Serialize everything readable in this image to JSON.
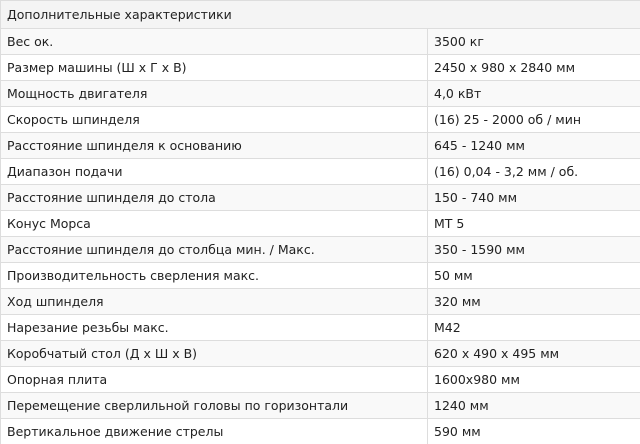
{
  "header": {
    "title": "Дополнительные характеристики"
  },
  "rows": [
    {
      "name": "Вес ок.",
      "value": "3500 кг"
    },
    {
      "name": "Размер машины (Ш х Г х В)",
      "value": "2450 x 980 x 2840 мм"
    },
    {
      "name": "Мощность двигателя",
      "value": "4,0 кВт"
    },
    {
      "name": "Скорость шпинделя",
      "value": "(16) 25 - 2000 об / мин"
    },
    {
      "name": "Расстояние шпинделя к основанию",
      "value": "645 - 1240 мм"
    },
    {
      "name": "Диапазон подачи",
      "value": "(16) 0,04 - 3,2 мм / об."
    },
    {
      "name": "Расстояние шпинделя до стола",
      "value": "150 - 740 мм"
    },
    {
      "name": "Конус Морса",
      "value": "MT 5"
    },
    {
      "name": "Расстояние шпинделя до столбца мин. / Макс.",
      "value": "350 - 1590 мм"
    },
    {
      "name": "Производительность сверления макс.",
      "value": "50 мм"
    },
    {
      "name": "Ход шпинделя",
      "value": "320 мм"
    },
    {
      "name": "Нарезание резьбы макс.",
      "value": "M42"
    },
    {
      "name": "Коробчатый стол (Д х Ш х В)",
      "value": "620 x 490 x 495 мм"
    },
    {
      "name": "Опорная плита",
      "value": "1600x980 мм"
    },
    {
      "name": "Перемещение сверлильной головы по горизонтали",
      "value": "1240 мм"
    },
    {
      "name": "Вертикальное движение стрелы",
      "value": "590 мм"
    }
  ]
}
